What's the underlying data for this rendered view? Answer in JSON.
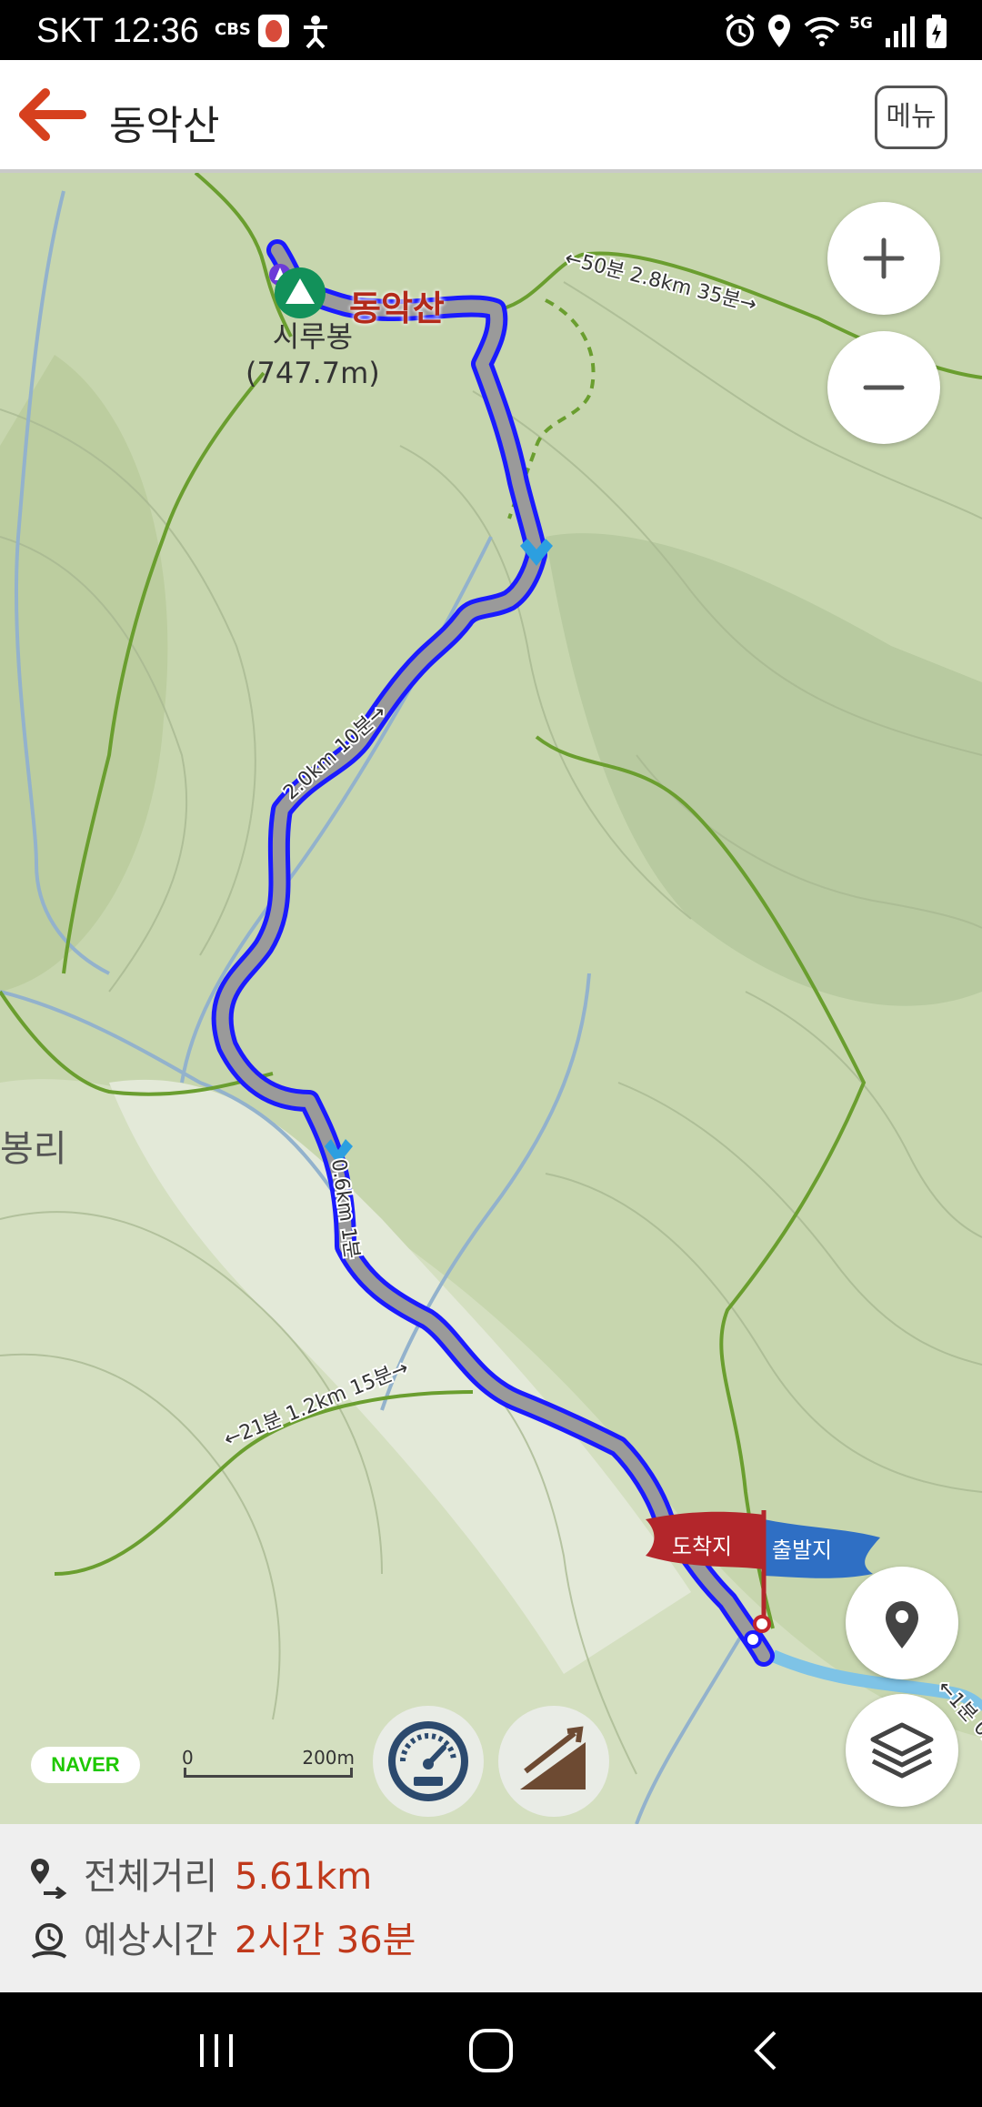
{
  "status_bar": {
    "carrier_time": "SKT 12:36",
    "cbs_label": "CBS",
    "network_label": "5G",
    "icons": [
      "health-icon",
      "accessibility-icon",
      "alarm-icon",
      "location-icon",
      "wifi-icon",
      "signal-icon",
      "battery-icon"
    ]
  },
  "app_bar": {
    "back_icon": "arrow-left-icon",
    "title": "동악산",
    "menu_label": "메뉴",
    "accent_color": "#d6401e"
  },
  "map": {
    "peak_name": "시루봉",
    "peak_elevation": "(747.7m)",
    "mountain_label": "동악산",
    "village_label": "봉리",
    "trail_labels": [
      "←50분 2.8km 35분→",
      "←21분 1.2km 15분→",
      "2.0km 10분→",
      "0.6km 1분",
      "←1분 0."
    ],
    "finish_flag": "도착지",
    "start_flag": "출발지",
    "zoom_in_label": "+",
    "zoom_out_label": "−",
    "naver_logo": "NAVER",
    "scale_zero": "0",
    "scale_distance": "200m",
    "route_color": "#1a1aff",
    "finish_flag_color": "#b3262b",
    "start_flag_color": "#2f6fc4"
  },
  "summary": {
    "distance_label": "전체거리",
    "distance_value": "5.61km",
    "time_label": "예상시간",
    "time_value": "2시간 36분",
    "value_color": "#c0391b"
  },
  "nav_bar": {
    "icons": [
      "recent-apps-icon",
      "home-icon",
      "back-icon"
    ]
  }
}
